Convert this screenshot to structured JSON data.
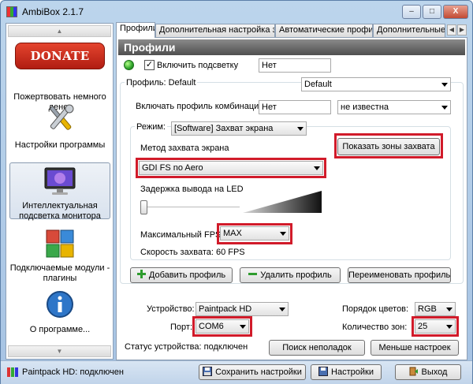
{
  "window": {
    "title": "AmbiBox 2.1.7",
    "minimize": "–",
    "maximize": "□",
    "close": "X"
  },
  "colors": {
    "highlight": "#d11b2a",
    "header_bg": "#5a5a5a",
    "donate_red": "#c62a1b"
  },
  "sidebar": {
    "items": [
      {
        "icon": "donate-now-badge",
        "badge_text": "DONATE NOW",
        "label": "Пожертвовать немного денег"
      },
      {
        "icon": "tools-icon",
        "label": "Настройки программы"
      },
      {
        "icon": "monitor-icon",
        "label": "Интеллектуальная подсветка монитора",
        "selected": true
      },
      {
        "icon": "puzzle-icon",
        "label": "Подключаемые модули - плагины"
      },
      {
        "icon": "info-icon",
        "label": "О программе..."
      }
    ]
  },
  "tabs": [
    "Профили",
    "Дополнительная настройка зон",
    "Автоматические профили",
    "Дополнительные н"
  ],
  "panel": {
    "header": "Профили",
    "enable_backlight_label": "Включить подсветку",
    "enable_backlight_checked": true,
    "enable_backlight_value": "Нет",
    "profile_label": "Профиль: Default",
    "profile_value": "Default",
    "combo_profile_label": "Включать профиль комбинацией:",
    "combo_profile_value": "Нет",
    "combo_profile_select": "не известна",
    "mode_label": "Режим:",
    "mode_value": "[Software] Захват экрана",
    "capture_method_label": "Метод захвата экрана",
    "capture_method_value": "GDI FS no Aero",
    "show_zones_button": "Показать зоны захвата",
    "led_delay_label": "Задержка вывода на LED",
    "max_fps_label": "Максимальный FPS",
    "max_fps_value": "MAX",
    "capture_speed": "Скорость захвата: 60 FPS",
    "add_profile": "Добавить профиль",
    "delete_profile": "Удалить профиль",
    "rename_profile": "Переименовать профиль",
    "device_label": "Устройство:",
    "device_value": "Paintpack HD",
    "color_order_label": "Порядок цветов:",
    "color_order_value": "RGB",
    "port_label": "Порт:",
    "port_value": "COM6",
    "zones_label": "Количество зон:",
    "zones_value": "25",
    "device_status": "Статус устройства: подключен",
    "troubleshoot_button": "Поиск неполадок",
    "fewer_settings_button": "Меньше настроек"
  },
  "statusbar": {
    "device_text": "Paintpack HD: подключен",
    "save_button": "Сохранить настройки",
    "settings_button": "Настройки",
    "exit_button": "Выход"
  }
}
